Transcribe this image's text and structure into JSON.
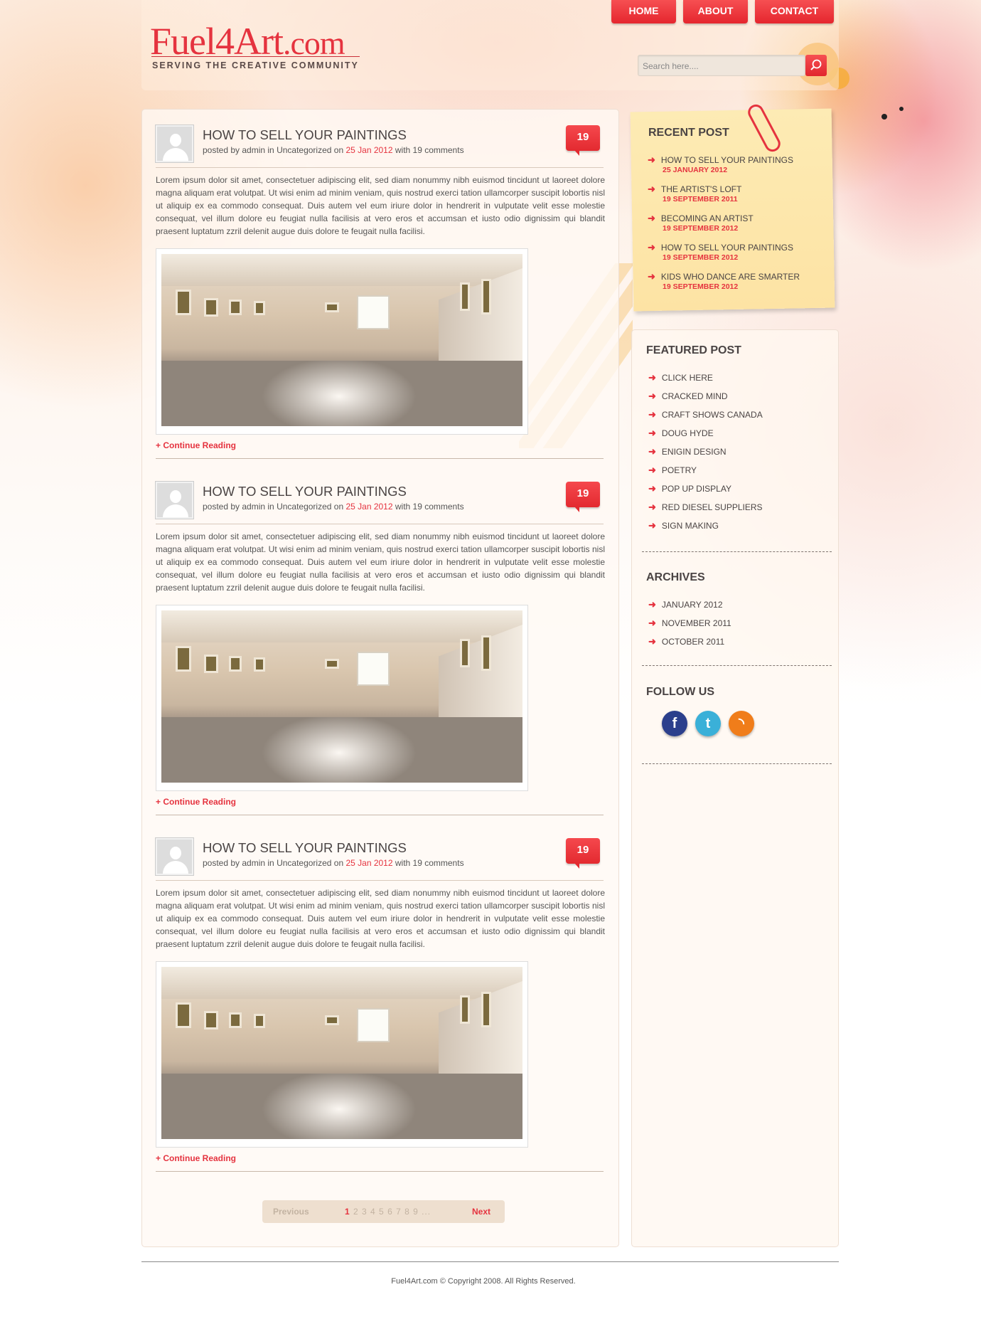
{
  "header": {
    "logo_text": "Fuel4Art",
    "logo_suffix": ".com",
    "tagline": "SERVING THE CREATIVE COMMUNITY",
    "nav": [
      "HOME",
      "ABOUT",
      "CONTACT"
    ],
    "search_placeholder": "Search here...."
  },
  "posts": [
    {
      "title": "HOW TO SELL YOUR PAINTINGS",
      "meta_prefix": "posted by admin in Uncategorized on ",
      "date": "25 Jan 2012",
      "meta_suffix": " with 19 comments",
      "comments": "19",
      "excerpt": "Lorem ipsum dolor sit amet, consectetuer adipiscing elit, sed diam nonummy nibh euismod tincidunt ut laoreet dolore magna aliquam erat volutpat. Ut wisi enim ad minim veniam, quis nostrud exerci tation ullamcorper suscipit lobortis nisl ut aliquip ex ea commodo consequat. Duis autem vel eum iriure dolor in hendrerit in vulputate velit esse molestie consequat, vel illum dolore eu feugiat nulla facilisis at vero eros et accumsan et iusto odio dignissim qui blandit praesent luptatum zzril delenit augue duis dolore te feugait nulla facilisi.",
      "continue": "+ Continue Reading"
    },
    {
      "title": "HOW TO SELL YOUR PAINTINGS",
      "meta_prefix": "posted by admin in Uncategorized on ",
      "date": "25 Jan 2012",
      "meta_suffix": " with 19 comments",
      "comments": "19",
      "excerpt": "Lorem ipsum dolor sit amet, consectetuer adipiscing elit, sed diam nonummy nibh euismod tincidunt ut laoreet dolore magna aliquam erat volutpat. Ut wisi enim ad minim veniam, quis nostrud exerci tation ullamcorper suscipit lobortis nisl ut aliquip ex ea commodo consequat. Duis autem vel eum iriure dolor in hendrerit in vulputate velit esse molestie consequat, vel illum dolore eu feugiat nulla facilisis at vero eros et accumsan et iusto odio dignissim qui blandit praesent luptatum zzril delenit augue duis dolore te feugait nulla facilisi.",
      "continue": "+ Continue Reading"
    },
    {
      "title": "HOW TO SELL YOUR PAINTINGS",
      "meta_prefix": "posted by admin in Uncategorized on ",
      "date": "25 Jan 2012",
      "meta_suffix": " with 19 comments",
      "comments": "19",
      "excerpt": "Lorem ipsum dolor sit amet, consectetuer adipiscing elit, sed diam nonummy nibh euismod tincidunt ut laoreet dolore magna aliquam erat volutpat. Ut wisi enim ad minim veniam, quis nostrud exerci tation ullamcorper suscipit lobortis nisl ut aliquip ex ea commodo consequat. Duis autem vel eum iriure dolor in hendrerit in vulputate velit esse molestie consequat, vel illum dolore eu feugiat nulla facilisis at vero eros et accumsan et iusto odio dignissim qui blandit praesent luptatum zzril delenit augue duis dolore te feugait nulla facilisi.",
      "continue": "+ Continue Reading"
    }
  ],
  "pagination": {
    "prev": "Previous",
    "current": "1",
    "pages": "2 3 4 5 6 7 8 9 ...",
    "next": "Next"
  },
  "sidebar": {
    "recent_heading": "RECENT POST",
    "recent": [
      {
        "title": "HOW TO SELL YOUR PAINTINGS",
        "date": "25 JANUARY 2012"
      },
      {
        "title": "THE ARTIST'S LOFT",
        "date": "19 SEPTEMBER 2011"
      },
      {
        "title": "BECOMING AN ARTIST",
        "date": "19 SEPTEMBER 2012"
      },
      {
        "title": "HOW TO SELL YOUR PAINTINGS",
        "date": "19 SEPTEMBER 2012"
      },
      {
        "title": "KIDS WHO DANCE ARE SMARTER",
        "date": "19 SEPTEMBER 2012"
      }
    ],
    "featured_heading": "FEATURED POST",
    "featured": [
      "CLICK HERE",
      "CRACKED MIND",
      "CRAFT SHOWS CANADA",
      "DOUG HYDE",
      "ENIGIN DESIGN",
      "POETRY",
      "POP UP DISPLAY",
      "RED DIESEL SUPPLIERS",
      "SIGN MAKING"
    ],
    "archives_heading": "ARCHIVES",
    "archives": [
      "JANUARY 2012",
      "NOVEMBER 2011",
      "OCTOBER 2011"
    ],
    "follow_heading": "FOLLOW US",
    "social": [
      {
        "icon": "facebook-icon",
        "glyph": "f",
        "color": "#2b3f8c"
      },
      {
        "icon": "twitter-icon",
        "glyph": "t",
        "color": "#3ab0d8"
      },
      {
        "icon": "rss-icon",
        "glyph": "◝",
        "color": "#f07d1a"
      }
    ]
  },
  "footer": {
    "copyright": "Fuel4Art.com © Copyright 2008. All Rights Reserved."
  },
  "colors": {
    "accent": "#e5333f",
    "sticky_note": "#fde6a8",
    "text": "#4a4444"
  }
}
